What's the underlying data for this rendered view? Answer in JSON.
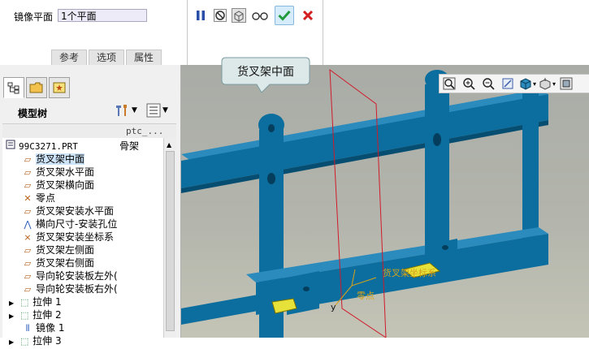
{
  "dashboard": {
    "mirror_plane_label": "镜像平面",
    "reference_value": "1个平面",
    "tabs": [
      "参考",
      "选项",
      "属性"
    ],
    "colors": {
      "ok": "#1f9a3c",
      "cancel": "#d31f1f",
      "pause": "#2a4fa8"
    }
  },
  "tooltip": {
    "text": "货叉架中面"
  },
  "model_tree": {
    "title": "模型树",
    "column_header": "ptc_...",
    "root": {
      "name": "99C3271.PRT",
      "value": "骨架"
    },
    "items": [
      {
        "label": "货叉架中面",
        "icon": "datum-plane-icon",
        "selected": true
      },
      {
        "label": "货叉架水平面",
        "icon": "datum-plane-icon"
      },
      {
        "label": "货叉架横向面",
        "icon": "datum-plane-icon"
      },
      {
        "label": "零点",
        "icon": "datum-point-icon"
      },
      {
        "label": "货叉架安装水平面",
        "icon": "datum-plane-icon"
      },
      {
        "label": "横向尺寸-安装孔位",
        "icon": "datum-axis-icon"
      },
      {
        "label": "货叉架安装坐标系",
        "icon": "coordinate-system-icon"
      },
      {
        "label": "货叉架左侧面",
        "icon": "datum-plane-icon"
      },
      {
        "label": "货叉架右侧面",
        "icon": "datum-plane-icon"
      },
      {
        "label": "导向轮安装板左外(",
        "icon": "datum-plane-icon"
      },
      {
        "label": "导向轮安装板右外(",
        "icon": "datum-plane-icon"
      },
      {
        "label": "拉伸 1",
        "icon": "extrude-icon",
        "expandable": true
      },
      {
        "label": "拉伸 2",
        "icon": "extrude-icon",
        "expandable": true
      },
      {
        "label": "镜像 1",
        "icon": "mirror-icon"
      },
      {
        "label": "拉伸 3",
        "icon": "extrude-icon",
        "expandable": true
      }
    ]
  },
  "viewport": {
    "annotations": [
      "货叉架坐标系",
      "零点",
      "y"
    ],
    "model_color": "#0b6e9e",
    "plane_color": "#d01a2a"
  }
}
